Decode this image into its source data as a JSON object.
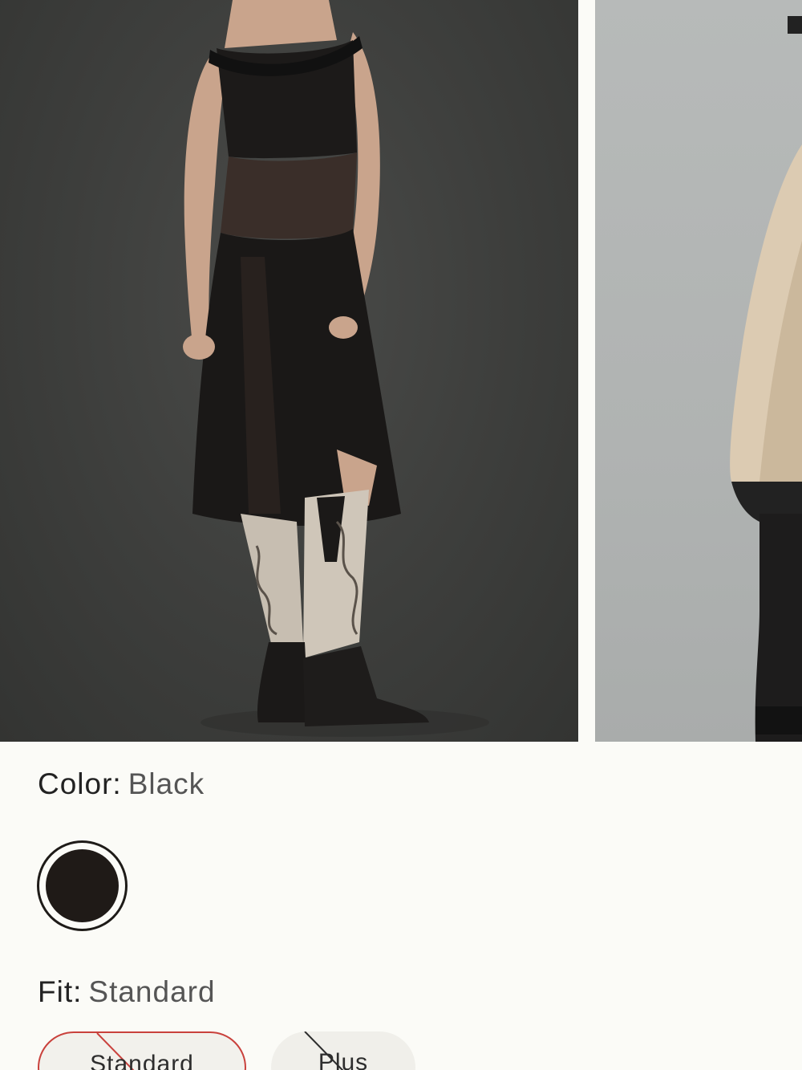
{
  "product": {
    "color_label": "Color:",
    "color_value": "Black",
    "fit_label": "Fit:",
    "fit_value": "Standard",
    "swatches": [
      {
        "name": "Black",
        "hex": "#1f1a17",
        "selected": true
      }
    ],
    "fit_options": [
      {
        "label": "Standard",
        "selected": true,
        "unavailable": true
      },
      {
        "label": "Plus",
        "selected": false,
        "unavailable": true
      }
    ]
  },
  "colors": {
    "selected_outline": "#c9413c",
    "background": "#fbfbf7"
  }
}
